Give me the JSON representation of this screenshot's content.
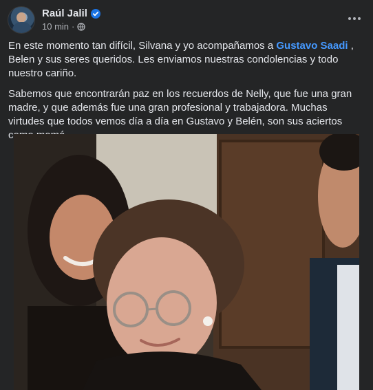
{
  "post": {
    "author": "Raúl Jalil",
    "time": "10 min",
    "separator": "·",
    "paragraph1": {
      "before": "En este momento tan difícil, Silvana y yo acompañamos a ",
      "mention": "Gustavo Saadi",
      "after": " , Belen y sus seres queridos. Les enviamos nuestras condolencias y todo nuestro cariño."
    },
    "paragraph2": "Sabemos que encontrarán paz en los recuerdos de Nelly, que fue una gran madre, y que además fue una gran profesional y trabajadora. Muchas virtudes que todos vemos día a día en Gustavo y Belén, son sus aciertos como mamá."
  },
  "icons": {
    "verified": "verified-badge-icon",
    "audience": "globe-icon",
    "more": "more-options-icon"
  },
  "colors": {
    "background": "#242526",
    "text": "#e4e6eb",
    "secondary_text": "#b0b3b8",
    "link": "#4599ff",
    "verified": "#1b74e4"
  }
}
